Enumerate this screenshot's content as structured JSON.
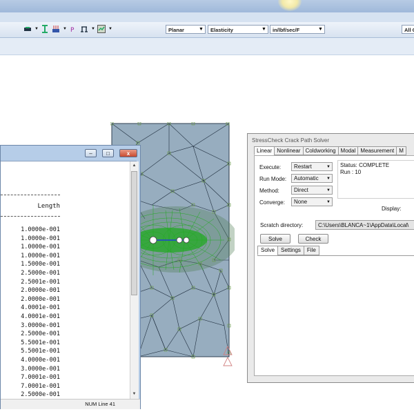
{
  "toolbar": {
    "dropdowns": [
      {
        "value": "Planar"
      },
      {
        "value": "Elasticity"
      },
      {
        "value": "in/lbf/sec/F"
      },
      {
        "value": "All G"
      }
    ],
    "icons": [
      "mesh-icon",
      "dimension-icon",
      "load-icon",
      "property-icon",
      "constraint-icon",
      "crack-icon"
    ]
  },
  "console": {
    "column_header": "Length",
    "values": [
      "1.0000e-001",
      "1.0000e-001",
      "1.0000e-001",
      "1.0000e-001",
      "1.5000e-001",
      "2.5000e-001",
      "2.5001e-001",
      "2.0000e-001",
      "2.0000e-001",
      "4.0001e-001",
      "4.0001e-001",
      "3.0000e-001",
      "2.5000e-001",
      "5.5001e-001",
      "5.5001e-001",
      "4.0000e-001",
      "3.0000e-001",
      "7.0001e-001",
      "7.0001e-001",
      "2.5000e-001"
    ],
    "status": "NUM  Line 41",
    "window_buttons": {
      "minimize": "–",
      "maximize": "□",
      "close": "x"
    }
  },
  "solver": {
    "title": "StressCheck Crack Path Solver",
    "tabs": [
      "Linear",
      "Nonlinear",
      "Coldworking",
      "Modal",
      "Measurement",
      "M"
    ],
    "active_tab": "Linear",
    "fields": {
      "execute_label": "Execute:",
      "execute_value": "Restart",
      "runmode_label": "Run Mode:",
      "runmode_value": "Automatic",
      "method_label": "Method:",
      "method_value": "Direct",
      "converge_label": "Converge:",
      "converge_value": "None"
    },
    "status_line1": "Status: COMPLETE",
    "status_line2": "Run : 10",
    "display_label": "Display:",
    "scratch_label": "Scratch directory:",
    "scratch_path": "C:\\Users\\BLANCA~1\\AppData\\Local\\",
    "solve_button": "Solve",
    "check_button": "Check",
    "subtabs": [
      "Solve",
      "Settings",
      "File"
    ],
    "active_subtab": "Solve"
  },
  "colors": {
    "mesh_fill": "#97adbf",
    "mesh_lines": "#1e2d3d",
    "refinement": "#22aa22",
    "node": "#6b9a4f",
    "crack": "#1d3fd4"
  }
}
